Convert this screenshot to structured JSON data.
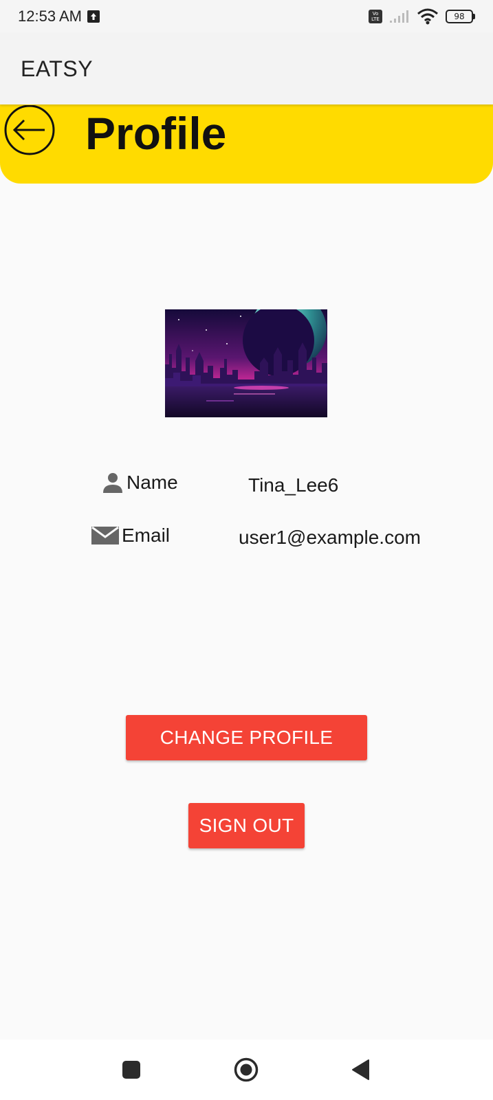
{
  "status_bar": {
    "time": "12:53 AM",
    "battery": "98",
    "volte_top": "Vo",
    "volte_bottom": "LTE"
  },
  "app_bar": {
    "title": "EATSY"
  },
  "header": {
    "title": "Profile",
    "color": "#ffdb00"
  },
  "profile": {
    "name_label": "Name",
    "name_value": "Tina_Lee6",
    "email_label": "Email",
    "email_value": "user1@example.com"
  },
  "actions": {
    "change_profile": "CHANGE PROFILE",
    "sign_out": "SIGN OUT",
    "button_color": "#f44336"
  },
  "icons": {
    "back": "arrow-left-circle-icon",
    "name": "person-icon",
    "email": "envelope-icon"
  }
}
